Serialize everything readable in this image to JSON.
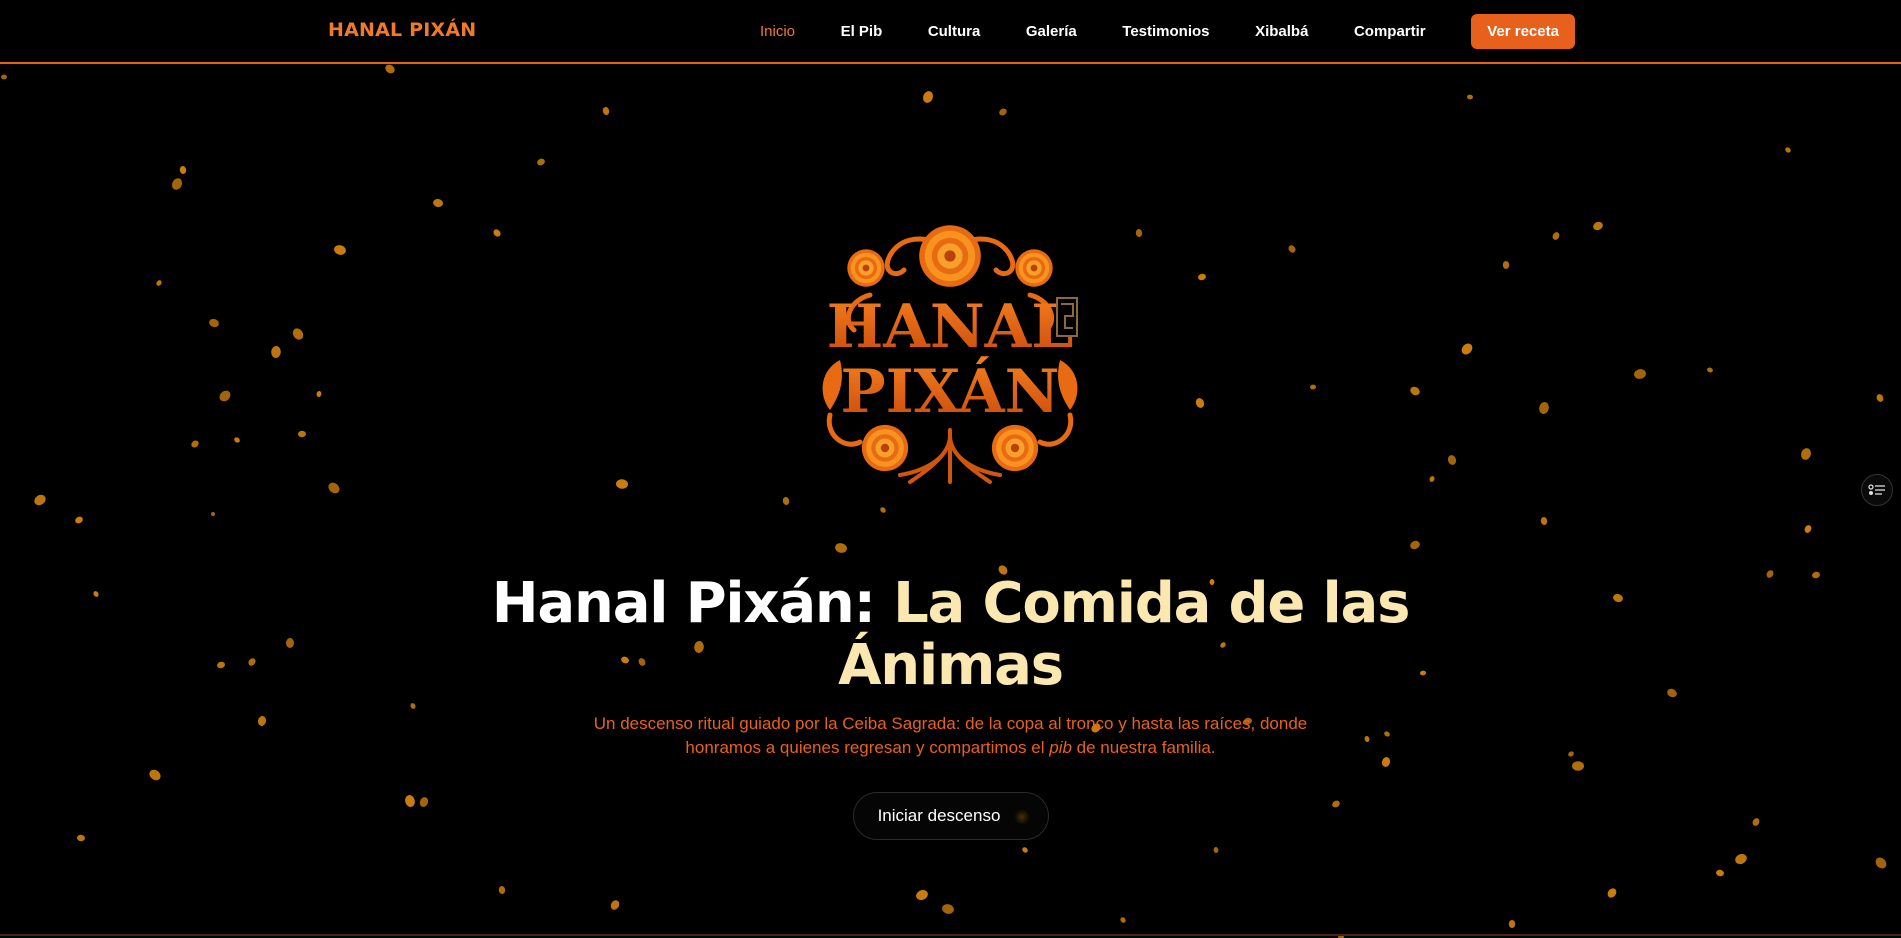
{
  "colors": {
    "background": "#000000",
    "accent": "#e8611c",
    "accent_text": "#f07a2a",
    "title_accent": "#fbe7b0",
    "petal": "#d9860f"
  },
  "nav": {
    "brand": "HANAL PIXÁN",
    "links": [
      {
        "label": "Inicio",
        "active": true
      },
      {
        "label": "El Pib"
      },
      {
        "label": "Cultura"
      },
      {
        "label": "Galería"
      },
      {
        "label": "Testimonios"
      },
      {
        "label": "Xibalbá"
      },
      {
        "label": "Compartir"
      }
    ],
    "cta": "Ver receta"
  },
  "emblem": {
    "line1": "HANAL",
    "line2": "PIXÁN",
    "icon": "marigold-emblem-icon"
  },
  "hero": {
    "title_main": "Hanal Pixán:",
    "title_accent": "La Comida de las Ánimas",
    "subtitle_part1": "Un descenso ritual guiado por la Ceiba Sagrada: de la copa al tronco y hasta las raíces, donde honramos a quienes regresan y compartimos el",
    "subtitle_em": "pib",
    "subtitle_part2": "de nuestra familia.",
    "button": "Iniciar descenso"
  },
  "side_toggle": {
    "icon": "toggle-menu-icon"
  }
}
